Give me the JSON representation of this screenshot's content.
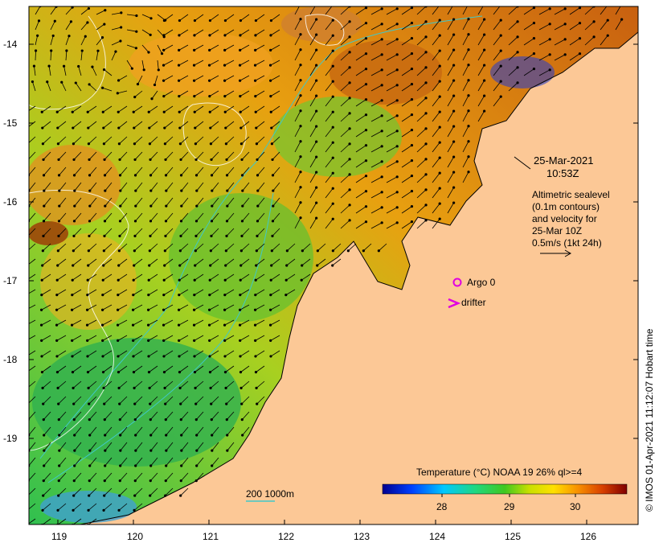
{
  "map": {
    "y_ticks": [
      "-14",
      "-15",
      "-16",
      "-17",
      "-18",
      "-19"
    ],
    "x_ticks": [
      "119",
      "120",
      "121",
      "122",
      "123",
      "124",
      "125",
      "126"
    ],
    "timestamp_date": "25-Mar-2021",
    "timestamp_time": "10:53Z",
    "legend_lines": [
      "Altimetric sealevel",
      "(0.1m contours)",
      "and velocity for",
      "25-Mar 10Z",
      "0.5m/s (1kt 24h)"
    ],
    "argo_label": "Argo 0",
    "drifter_label": "drifter",
    "depth_label": "200  1000m",
    "colorbar_title": "Temperature (°C) NOAA 19 26% ql>=4",
    "colorbar_ticks": [
      "28",
      "29",
      "30"
    ],
    "credit": "© IMOS 01-Apr-2021 11:12:07 Hobart time"
  },
  "colors": {
    "land": "#fcc896",
    "contour": "#ffffff",
    "depth": "#40c8c8",
    "argo": "#e000e0",
    "drifter": "#e000e0"
  }
}
